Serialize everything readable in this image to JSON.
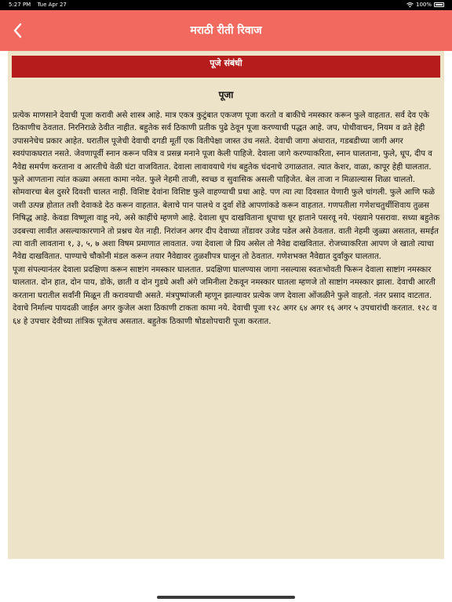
{
  "status_bar": {
    "time": "5:27 PM",
    "date": "Tue Apr 27",
    "battery": "100%"
  },
  "nav": {
    "title": "मराठी रीती रिवाज",
    "back_icon": "chevron-left-icon"
  },
  "section": {
    "header": "पूजे संबंधी"
  },
  "article": {
    "title": "पूजा",
    "paragraphs": [
      "प्रत्येक माणसाने देवाची पूजा करावी असे शास्त्र आहे. मात्र एकत्र कुटुंबात एकजण पूजा करतो व बाकीचे नमस्कार करून फुले वाहतात. सर्व देव एके ठिकाणीच ठेवतात. निरनिराळे ठेवीत नाहीत. बहुतेक सर्व ठिकाणी प्रतीक पुढे ठेवून पूजा करण्याची पद्धत आहे. जप, पोथीवाचन, नियम व व्रते हेही उपासनेचेच प्रकार आहेत. घरातील पूजेची देवाची दगडी मूर्ती एक वितीपेक्षा जास्त उंच नसते. देवाची जागा अंधारात, गडबडीच्या जागी अगर स्वयंपाकघरात नसते. जेवणापूर्वी स्नान करून पवित्र व प्रसन्न मनाने पूजा केली पाहिजे. देवाला जागे करण्याकरिता, स्नान घालताना, फुले, धूप, दीप व नैवेद्य समर्पण करताना व आरतीचे वेळी घंटा वाजवितात. देवाला लावावयाचे गंध बहुतेक चंदनाचे उगाळतात. त्यात केशर, वाळा, कापूर हेही घालतात.",
      "फुले आणताना त्यांत कळ्या असता कामा नयेत. फुले नेहमी ताजी, स्वच्छ व सुवासिक असली पाहिजेत. बेल ताजा न मिळाल्यास शिळा चालतो. सोमवारचा बेल दुसरे दिवशी चालत नाही. विशिष्ट देवांना विशिष्ट फुले वाहण्याची प्रथा आहे. पण त्या त्या दिवसात येणारी फुले चांगली. फुले आणि फळे जशी उत्पन्न होतात तशी देवाकडे देठ करून वाहतात. बेलाचे पान पालथे व दुर्वा शेंडे आपणांकडे करून वाहतात. गणपतीला गणेशचतुर्थीशिवाय तुळस निषिद्ध आहे. केवडा विष्णूला वाहू नये, असे काहींचे म्हणणे आहे. देवाला धूप दाखविताना धूपाचा धूर हाताने पसरवू नये. पंख्याने पसरावा. सध्या बहुतेक उदबत्त्या लावीत असल्याकारणाने तो प्रश्नच येत नाही. निरांजन अगर दीप देवाच्या तोंडावर उजेड पडेल असे ठेवतात. वाती नेहमी जुळ्या असतात, समईत त्या वाती लावताना १, ३, ५, ७ अशा विषम प्रमाणात लावतात. ज्या देवाला जे प्रिय असेल तो नैवेद्य दाखवितात. रोजच्याकरिता आपण जे खातो त्याचा नैवेद्य दाखवितात. पाण्याचे चौकोनी मंडल करून तयार नैवेद्यावर तुळशीपत्र घालून तो ठेवतात. गणेशभक्त नैवेद्यात दुर्वांकुर घालतात.",
      "पूजा संपल्यानंतर देवाला प्रदक्षिणा करून साष्टांग नमस्कार घालतात. प्रदक्षिणा घालण्यास जागा नसल्यास स्वतःभोवती फिरून देवाला साष्टांग नमस्कार घालतात. दोन हात, दोन पाय, डोके, छाती व दोन गुडघे अशी अंगे जमिनीला टेकवून नमस्कार घातला म्हणजे तो साष्टांग नमस्कार झाला. देवाची आरती करताना घरातील सर्वांनी मिळून ती करावयाची असते. मंत्रपुष्पांजली म्हणून झाल्यावर प्रत्येक जण देवाला ओंजळीने फुले वाहतो. नंतर प्रसाद वाटतात. देवाचे निर्माल्य पायदळी जाईल अगर कुजेल अशा ठिकाणी टाकता कामा नये. देवाची पूजा १२८ अगर ६४ अगर १६ अगर ५ उपचारांची करतात. १२८ व ६४ हे उपचार देवीच्या तांत्रिक पूजेतच असतात. बहुतेक ठिकाणी षोडशोपचारी पूजा करतात."
    ]
  },
  "colors": {
    "nav_bar": "#f26a5f",
    "section_header": "#b71c1c",
    "content_bg": "#ede3c8"
  }
}
